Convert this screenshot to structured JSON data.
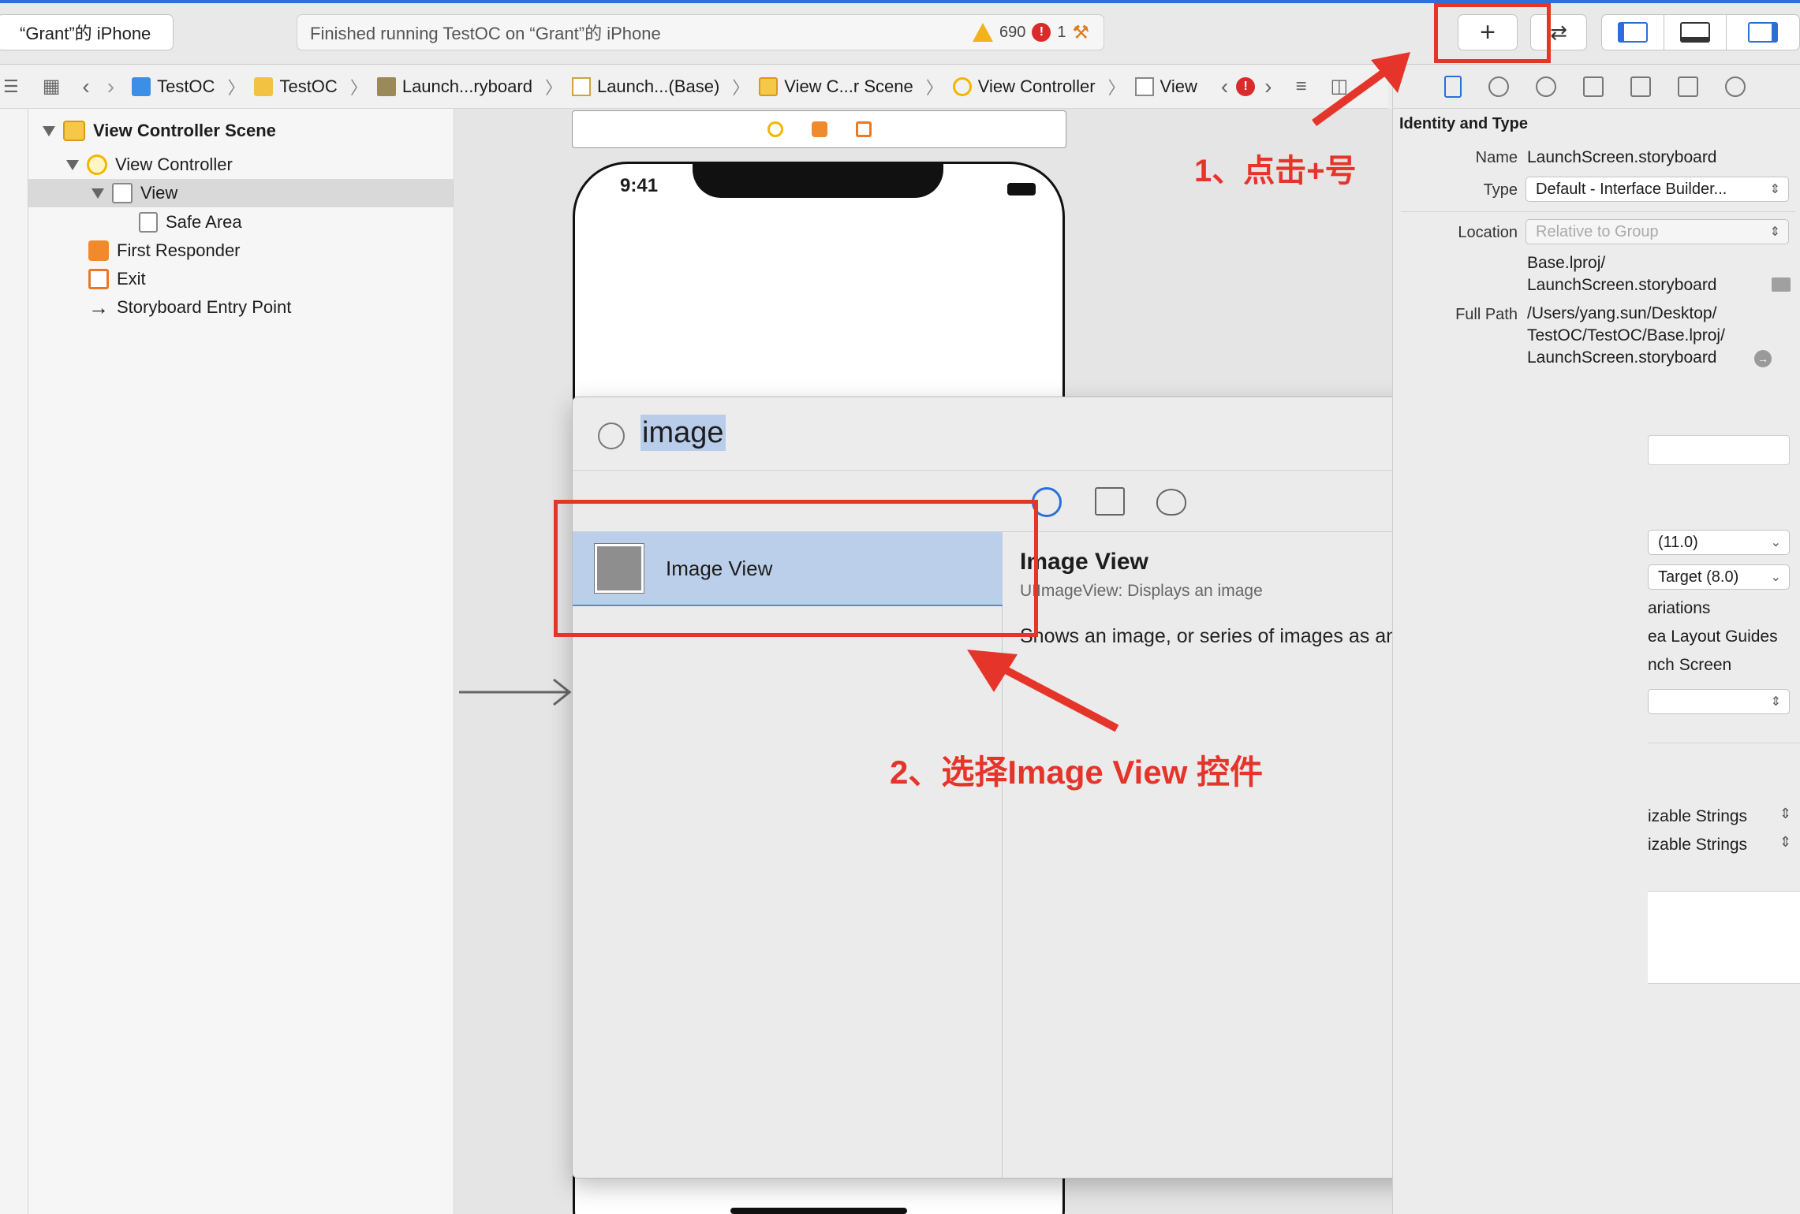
{
  "toolbar": {
    "scheme_label": "“Grant”的 iPhone",
    "activity_text": "Finished running TestOC on “Grant”的 iPhone",
    "warning_count": "690",
    "error_count": "1",
    "plus_label": "+",
    "swap_label": "⇄"
  },
  "breadcrumbs": [
    {
      "label": "TestOC",
      "icon": "project-icon"
    },
    {
      "label": "TestOC",
      "icon": "folder-icon"
    },
    {
      "label": "Launch...ryboard",
      "icon": "storyboard-icon"
    },
    {
      "label": "Launch...(Base)",
      "icon": "file-icon"
    },
    {
      "label": "View C...r Scene",
      "icon": "scene-icon"
    },
    {
      "label": "View Controller",
      "icon": "view-controller-icon"
    },
    {
      "label": "View",
      "icon": "view-icon"
    }
  ],
  "outline": {
    "scene": "View Controller Scene",
    "view_controller": "View Controller",
    "view": "View",
    "safe_area": "Safe Area",
    "first_responder": "First Responder",
    "exit": "Exit",
    "entry_point": "Storyboard Entry Point"
  },
  "phone": {
    "time": "9:41"
  },
  "library": {
    "search_value": "image",
    "items": [
      {
        "label": "Image View"
      }
    ],
    "detail": {
      "title": "Image View",
      "subtitle": "UIImageView: Displays an image",
      "description": "Shows an image, or series of images as an animation."
    }
  },
  "inspector": {
    "section_title": "Identity and Type",
    "name_label": "Name",
    "name_value": "LaunchScreen.storyboard",
    "type_label": "Type",
    "type_value": "Default - Interface Builder...",
    "location_label": "Location",
    "location_value": "Relative to Group",
    "location_path_line1": "Base.lproj/",
    "location_path_line2": "LaunchScreen.storyboard",
    "fullpath_label": "Full Path",
    "fullpath_line1": "/Users/yang.sun/Desktop/",
    "fullpath_line2": "TestOC/TestOC/Base.lproj/",
    "fullpath_line3": "LaunchScreen.storyboard",
    "frag_builds_for": "(11.0)",
    "frag_target": "Target (8.0)",
    "frag_variations": "ariations",
    "frag_safe_area": "ea Layout Guides",
    "frag_launch": "nch Screen",
    "frag_loc1": "izable Strings",
    "frag_loc2": "izable Strings"
  },
  "annotations": {
    "step1": "1、点击+号",
    "step2": "2、选择Image View 控件"
  },
  "colors": {
    "accent_blue": "#2b6fd8",
    "annotation_red": "#e5352b",
    "selection_blue": "#bccfea"
  }
}
